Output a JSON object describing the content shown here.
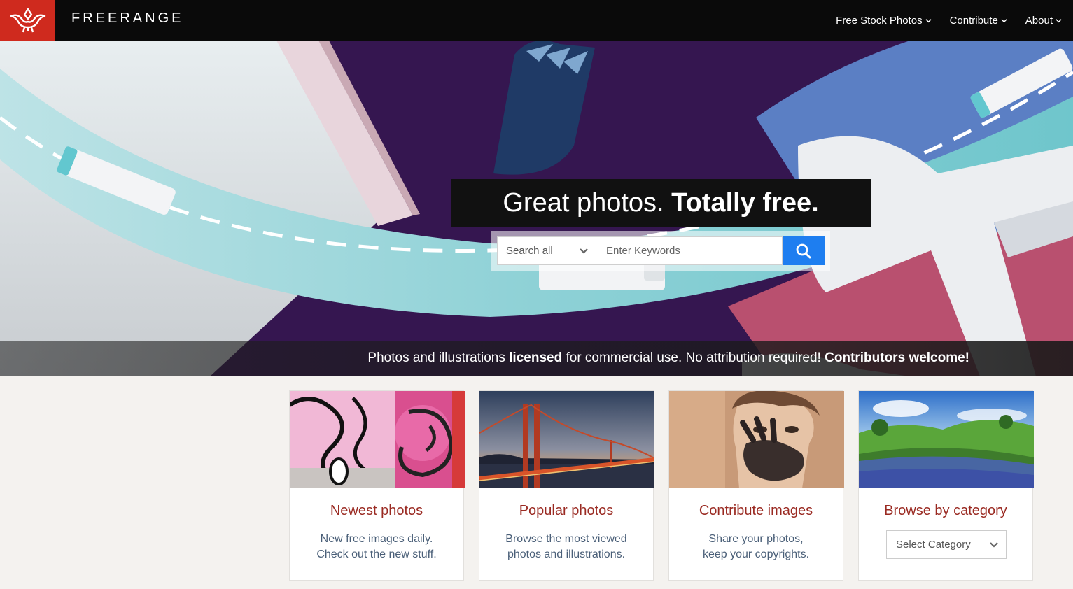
{
  "header": {
    "brand": "FREERANGE",
    "nav": [
      {
        "label": "Free Stock Photos"
      },
      {
        "label": "Contribute"
      },
      {
        "label": "About"
      }
    ]
  },
  "hero": {
    "headline_light": "Great photos.",
    "headline_bold": "Totally free.",
    "search": {
      "scope_value": "Search all",
      "placeholder": "Enter Keywords"
    },
    "tagline": {
      "part1": "Photos and illustrations ",
      "bold1": "licensed",
      "part2": " for commercial use. No attribution required! ",
      "bold2": "Contributors welcome!"
    }
  },
  "cards": [
    {
      "title": "Newest photos",
      "line1": "New free images daily.",
      "line2": "Check out the new stuff."
    },
    {
      "title": "Popular photos",
      "line1": "Browse the most viewed",
      "line2": "photos and illustrations."
    },
    {
      "title": "Contribute images",
      "line1": "Share your photos,",
      "line2": "keep your copyrights."
    },
    {
      "title": "Browse by category",
      "select_value": "Select Category"
    }
  ],
  "colors": {
    "brand_red": "#cf2a1e",
    "title_red": "#9a2a22",
    "search_blue": "#1e7ef0"
  }
}
